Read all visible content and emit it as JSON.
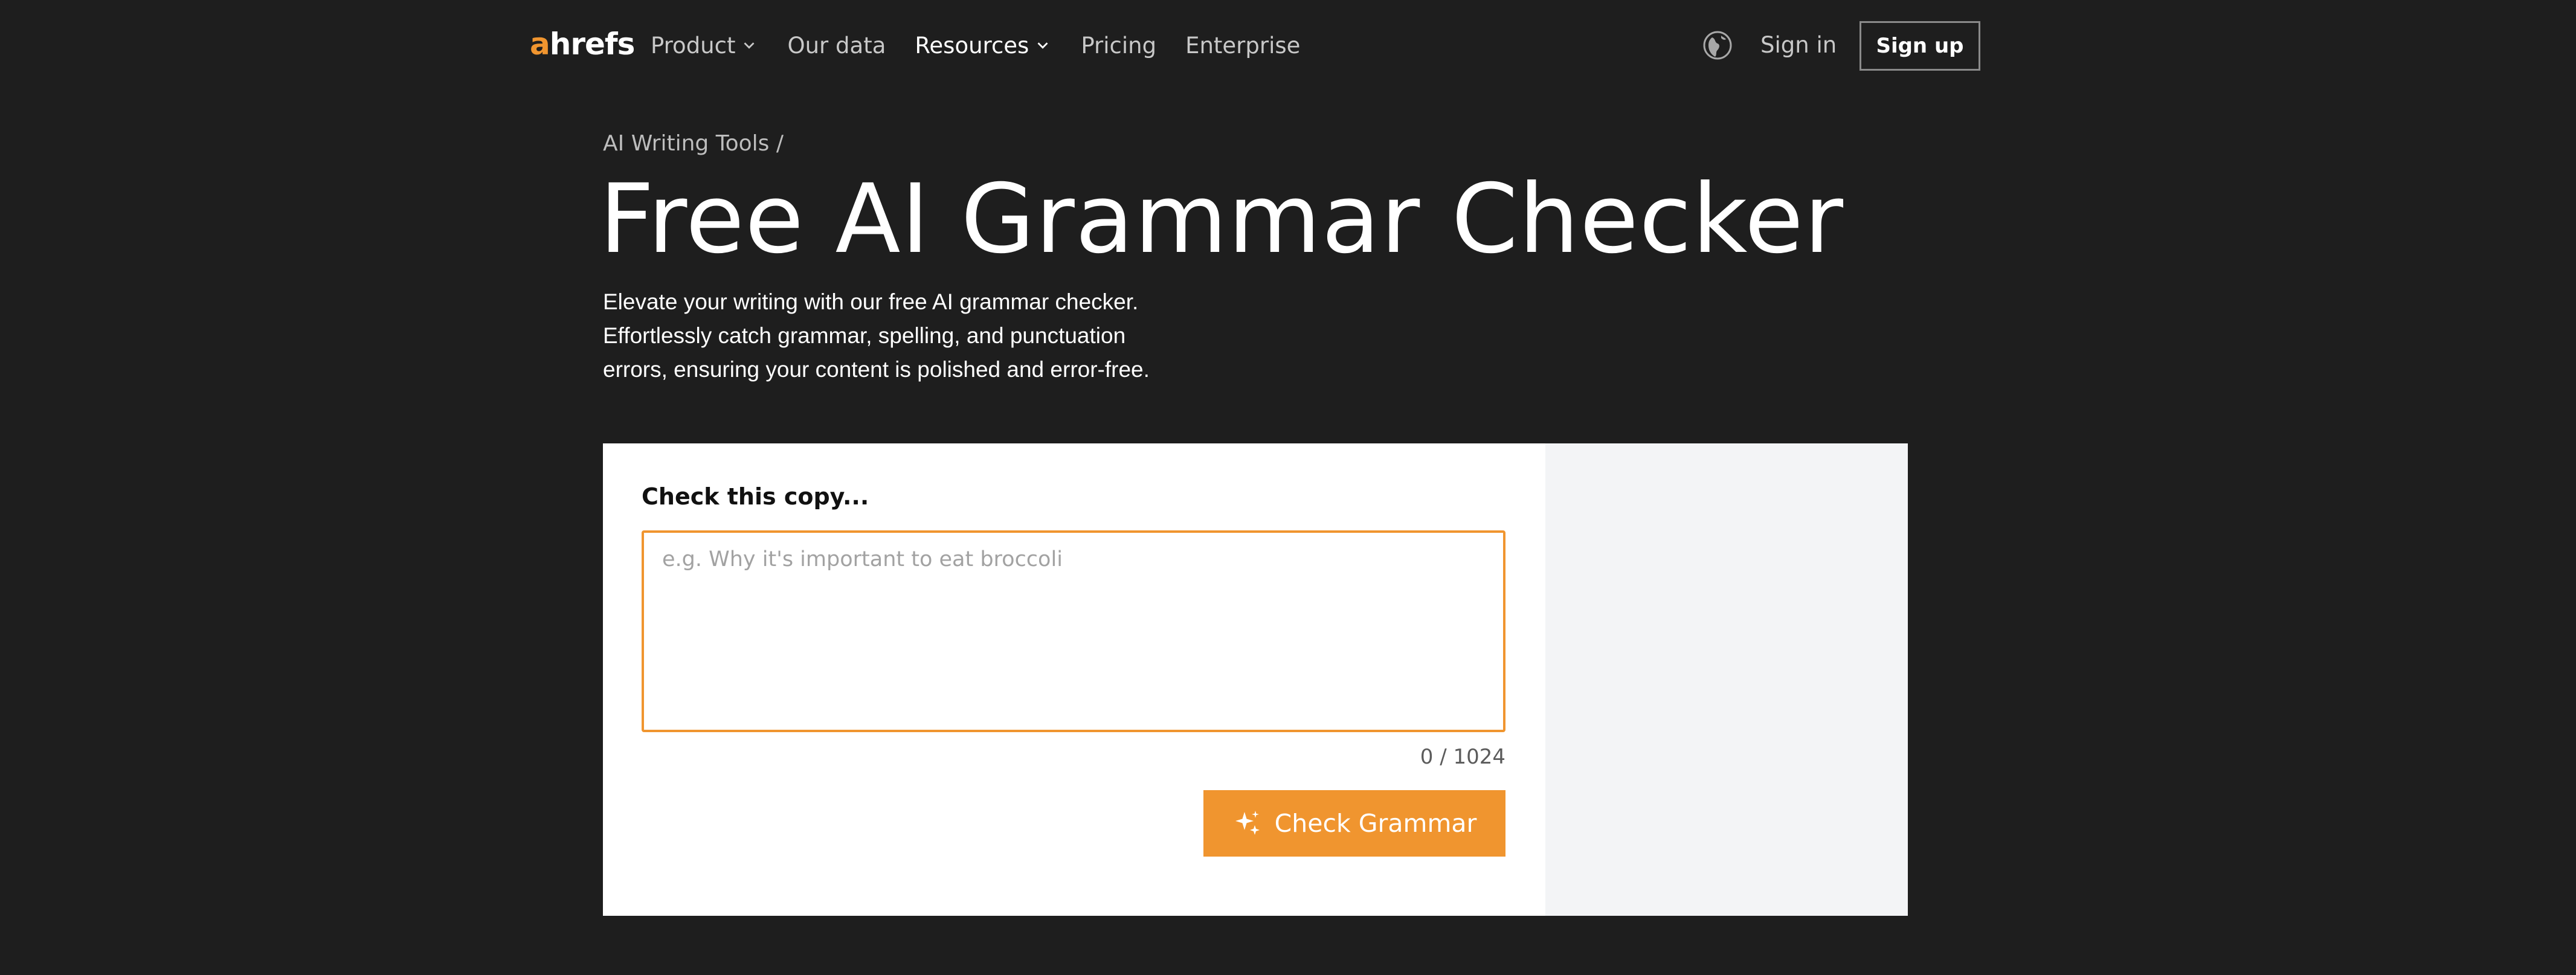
{
  "nav": {
    "logo_accent": "a",
    "logo_rest": "hrefs",
    "links": [
      {
        "label": "Product",
        "dropdown": true
      },
      {
        "label": "Our data",
        "dropdown": false
      },
      {
        "label": "Resources",
        "dropdown": true
      },
      {
        "label": "Pricing",
        "dropdown": false
      },
      {
        "label": "Enterprise",
        "dropdown": false
      }
    ],
    "globe_icon": "globe-icon",
    "signin_label": "Sign in",
    "signup_label": "Sign up"
  },
  "hero": {
    "breadcrumb": "AI Writing Tools /",
    "title": "Free AI Grammar Checker",
    "intro_lines": [
      "Elevate your writing with our free AI grammar checker.",
      "Effortlessly catch grammar, spelling, and punctuation",
      "errors, ensuring your content is polished and error-free."
    ]
  },
  "tool": {
    "label": "Check this copy...",
    "input_value": "",
    "input_placeholder": "e.g. Why it's important to eat broccoli",
    "counter": "0 / 1024",
    "button_label": "Check Grammar",
    "button_icon": "sparkles-icon"
  },
  "colors": {
    "background": "#1e1e1e",
    "accent": "#f0952f",
    "card": "#ffffff",
    "card_side": "#f3f4f6"
  }
}
